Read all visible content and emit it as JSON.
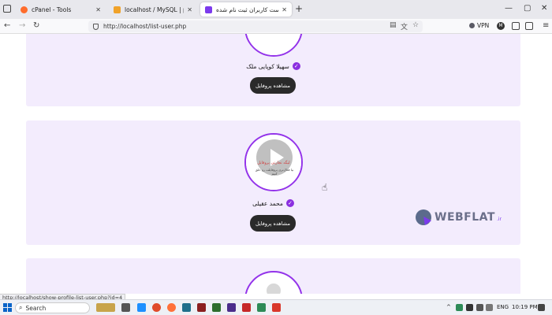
{
  "browser": {
    "tabs": [
      {
        "title": "cPanel - Tools",
        "favicon": "cpanel-icon",
        "active": false
      },
      {
        "title": "localhost / MySQL | phpMyAdmin",
        "favicon": "phpmyadmin-icon",
        "active": false
      },
      {
        "title": "لیست کاربران ثبت نام شده | webflat.ir",
        "favicon": "webflat-icon",
        "active": true
      }
    ],
    "new_tab": "+",
    "url": "http://localhost/list-user.php",
    "vpn_label": "VPN",
    "window_controls": {
      "minimize": "—",
      "maximize": "▢",
      "close": "✕"
    }
  },
  "cards": [
    {
      "name": "سهیلا کوپایی ملک",
      "button": "مشاهده پروفایل",
      "avatar": "video-text-avatar"
    },
    {
      "name": "محمد عقیلی",
      "button": "مشاهده پروفایل",
      "avatar": "video-thumbnail",
      "video_title": "لیگه تجارتی پروفایل",
      "video_sub": "بیا فعال‌تری پروفایلت رو خلق کنیم"
    },
    {
      "avatar": "default-user-icon"
    }
  ],
  "watermark": {
    "text": "WEBFLAT",
    "sub": ".ir"
  },
  "status_url": "http://localhost/show-profile-list-user.php?id=4",
  "taskbar": {
    "search_label": "Search",
    "language": "ENG",
    "time": "10:19 PM"
  },
  "colors": {
    "card_bg": "#f3ecfd",
    "accent": "#9333ea",
    "button": "#2a2a2a"
  }
}
